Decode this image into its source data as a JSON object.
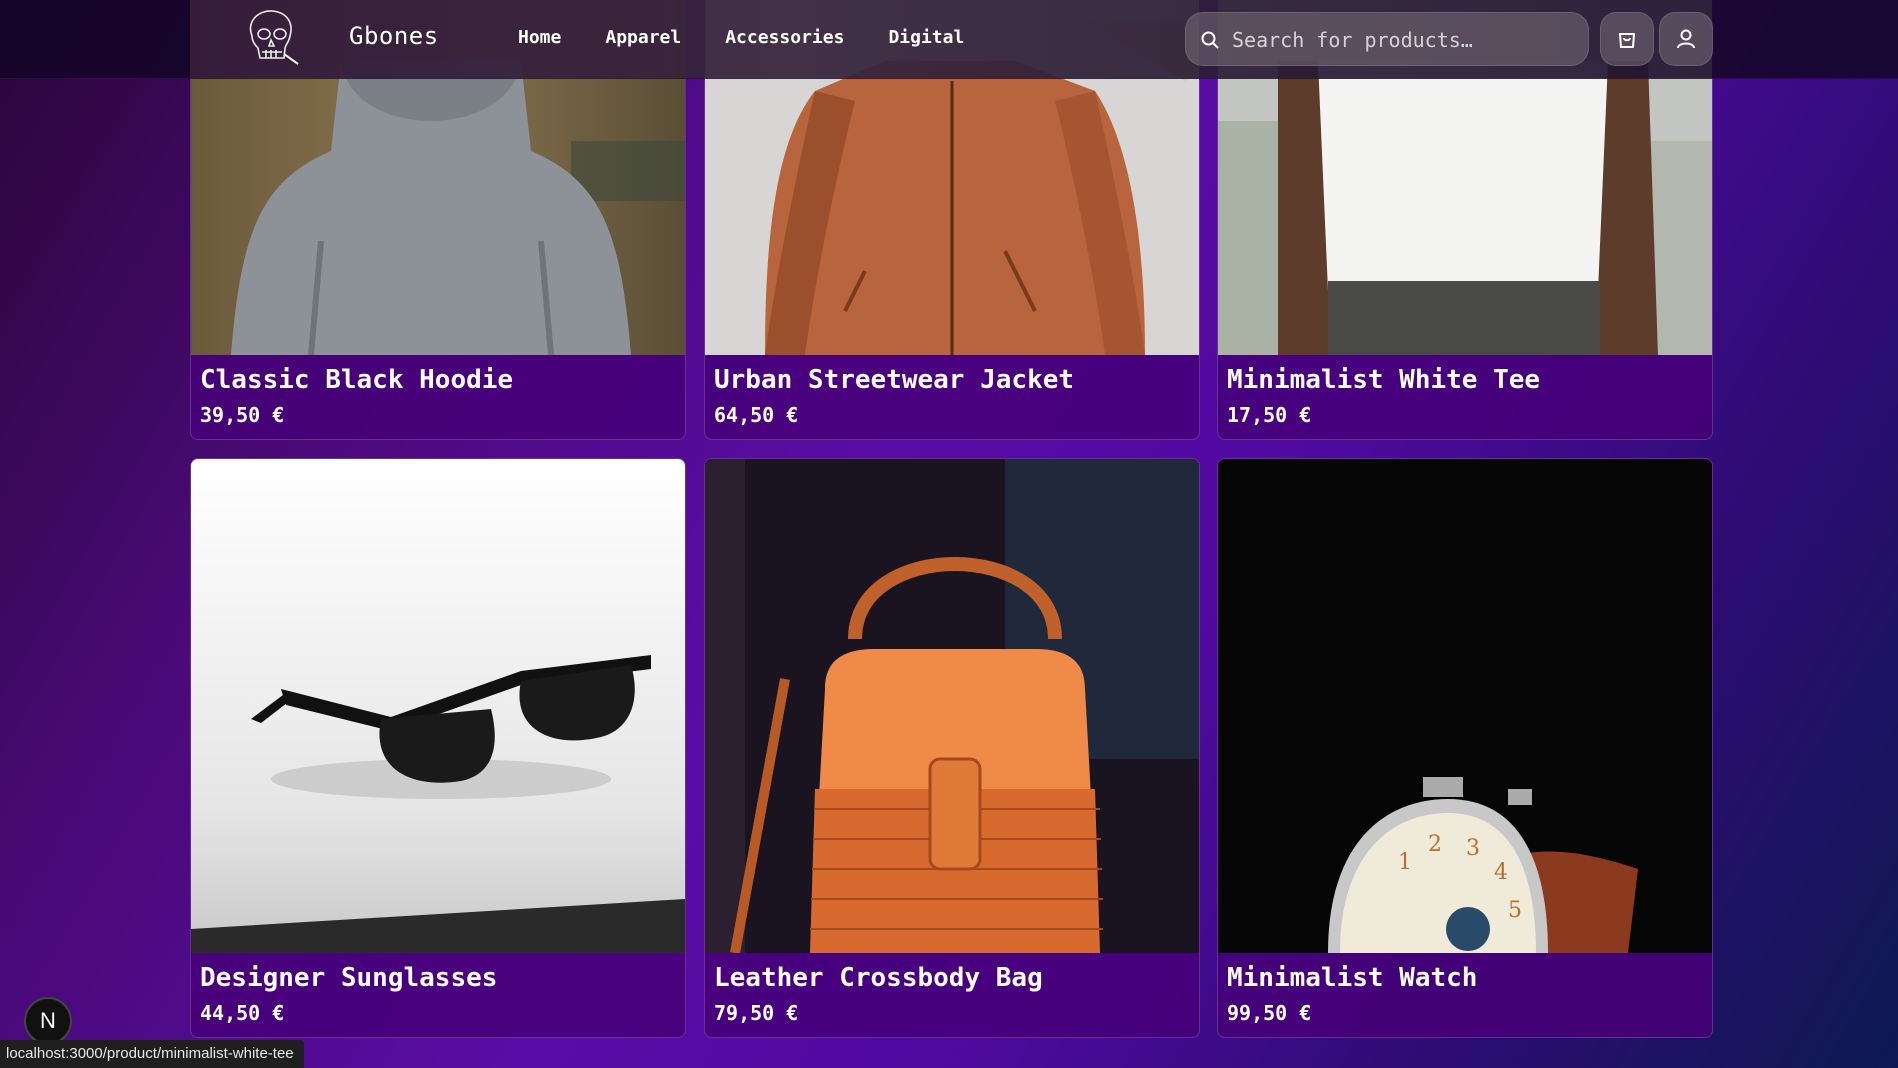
{
  "header": {
    "brand": "Gbones",
    "nav": [
      "Home",
      "Apparel",
      "Accessories",
      "Digital"
    ],
    "search_placeholder": "Search for products…",
    "cart_icon": "shopping-bag-icon",
    "user_icon": "user-icon",
    "logo_icon": "skull-icon"
  },
  "products": [
    {
      "name": "Classic Black Hoodie",
      "price": "39,50 €"
    },
    {
      "name": "Urban Streetwear Jacket",
      "price": "64,50 €"
    },
    {
      "name": "Minimalist White Tee",
      "price": "17,50 €"
    },
    {
      "name": "Designer Sunglasses",
      "price": "44,50 €"
    },
    {
      "name": "Leather Crossbody Bag",
      "price": "79,50 €"
    },
    {
      "name": "Minimalist Watch",
      "price": "99,50 €"
    }
  ],
  "status_bar": {
    "url": "localhost:3000/product/minimalist-white-tee"
  },
  "dev_badge": {
    "label": "N"
  },
  "colors": {
    "accent": "#5a0ca6",
    "header_bg": "#160628"
  }
}
